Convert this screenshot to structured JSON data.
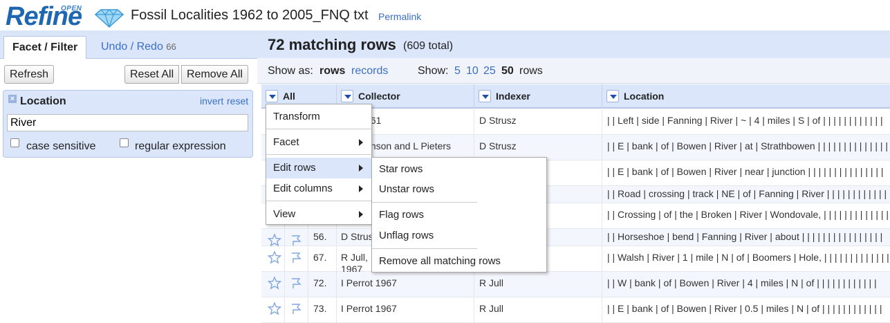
{
  "header": {
    "logo_top": "OPEN",
    "logo_main": "Refine",
    "project_title": "Fossil Localities 1962 to 2005_FNQ txt",
    "permalink": "Permalink"
  },
  "left": {
    "tabs": {
      "facet": "Facet / Filter",
      "undo": "Undo / Redo",
      "undo_count": "66"
    },
    "buttons": {
      "refresh": "Refresh",
      "reset_all": "Reset All",
      "remove_all": "Remove All"
    },
    "facet": {
      "title": "Location",
      "invert": "invert",
      "reset": "reset",
      "value": "River",
      "case_sensitive": "case sensitive",
      "regex": "regular expression"
    }
  },
  "summary": {
    "matching": "72 matching rows",
    "total": "(609 total)"
  },
  "view": {
    "show_as": "Show as:",
    "rows": "rows",
    "records": "records",
    "show": "Show:",
    "sizes": [
      "5",
      "10",
      "25",
      "50"
    ],
    "rows_suffix": "rows"
  },
  "columns": [
    "All",
    "Collector",
    "Indexer",
    "Location"
  ],
  "rows": [
    {
      "num": "",
      "collector": "...ot 1961",
      "indexer": "D Strusz",
      "location": "| | Left | side | Fanning | River | ~ | 4 | miles | S | of | | | | | | | | | | | |"
    },
    {
      "num": "",
      "collector": "...ephenson and L Pieters",
      "indexer": "D Strusz",
      "location": "| | E | bank | of | Bowen | River | at | Strathbowen | | | | | | | | | | | | | | |"
    },
    {
      "num": "",
      "collector": "",
      "indexer": "",
      "location": "| | E | bank | of | Bowen | River | near | junction | | | | | | | | | | | | | | |"
    },
    {
      "num": "",
      "collector": "",
      "indexer": "",
      "location": "| | Road | crossing | track | NE | of | Fanning | River | | | | | | | | | | | | |"
    },
    {
      "num": "",
      "collector": "",
      "indexer": "",
      "location": "| | Crossing | of | the | Broken | River | Wondovale, | | | | | | | | | | | | | |"
    },
    {
      "num": "56.",
      "collector": "D Strus...",
      "indexer": "",
      "location": "| | Horseshoe | bend | Fanning | River | about | | | | | | | | | | | | | | | |"
    },
    {
      "num": "67.",
      "collector": "R Jull,",
      "collector2": "1967",
      "indexer": "",
      "location": "| | Walsh | River | 1 | mile | N | of | Boomers | Hole, | | | | | | | | | | | | |"
    },
    {
      "num": "72.",
      "collector": "I Perrot 1967",
      "indexer": "R Jull",
      "location": "| | W | bank | of | Bowen | River | 4 | miles | N | of | | | | | | | | | | | |"
    },
    {
      "num": "73.",
      "collector": "I Perrot 1967",
      "indexer": "R Jull",
      "location": "| | E | bank | of | Bowen | River | 0.5 | miles | N | of | | | | | | | | | | | |"
    }
  ],
  "menu": {
    "transform": "Transform",
    "facet": "Facet",
    "edit_rows": "Edit rows",
    "edit_columns": "Edit columns",
    "view": "View"
  },
  "submenu": {
    "star": "Star rows",
    "unstar": "Unstar rows",
    "flag": "Flag rows",
    "unflag": "Unflag rows",
    "remove": "Remove all matching rows"
  },
  "colors": {
    "accent": "#3a6fc4",
    "panel": "#dbe6fb",
    "logo": "#1f67b0"
  }
}
